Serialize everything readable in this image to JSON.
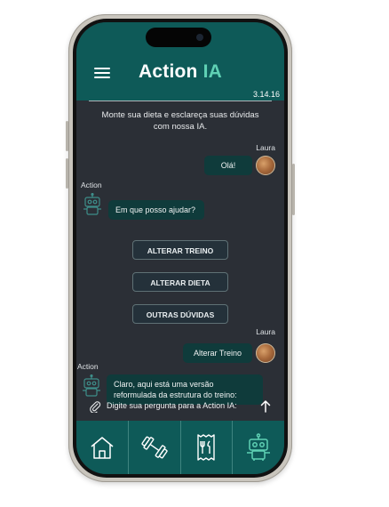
{
  "header": {
    "menu_icon": "hamburger-menu-icon",
    "brand_part1": "Action",
    "brand_part2": " IA",
    "version": "3.14.16"
  },
  "intro_line1": "Monte sua dieta e esclareça suas dúvidas",
  "intro_line2": "com nossa IA.",
  "messages": [
    {
      "sender": "Laura",
      "text": "Olá!"
    },
    {
      "sender": "Action",
      "text": "Em que posso ajudar?"
    },
    {
      "sender": "Laura",
      "text": "Alterar Treino"
    },
    {
      "sender": "Action",
      "text_line1": "Claro, aqui está uma versão",
      "text_line2": "reformulada da estrutura do treino:"
    }
  ],
  "options": [
    {
      "label": "ALTERAR TREINO"
    },
    {
      "label": "ALTERAR DIETA"
    },
    {
      "label": "OUTRAS DÚVIDAS"
    }
  ],
  "input": {
    "placeholder": "Digite sua pergunta para a Action IA:",
    "attach_icon": "paperclip-icon",
    "send_icon": "arrow-up-icon"
  },
  "nav": [
    {
      "icon": "home-icon"
    },
    {
      "icon": "dumbbell-icon"
    },
    {
      "icon": "menu-receipt-icon"
    },
    {
      "icon": "robot-icon"
    }
  ],
  "colors": {
    "header_bg": "#0e5a58",
    "screen_bg": "#2b2f36",
    "bubble_bg": "#0f3b3b",
    "brand_accent": "#5fd1b4"
  }
}
